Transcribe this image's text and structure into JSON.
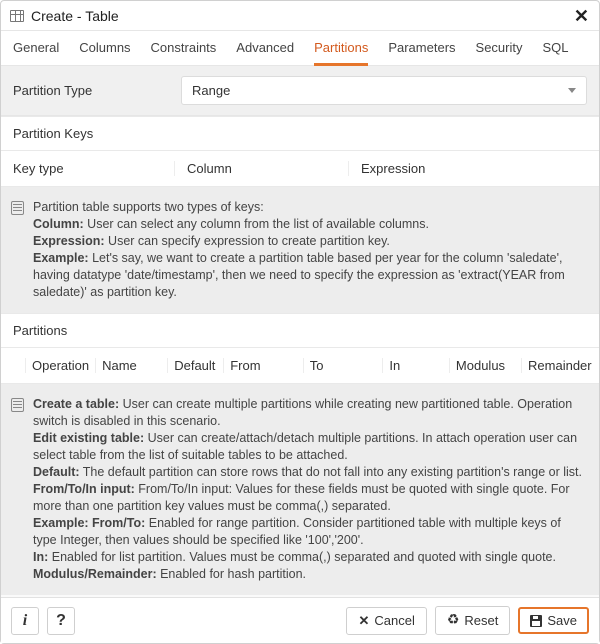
{
  "dialog_title": "Create - Table",
  "tabs": [
    "General",
    "Columns",
    "Constraints",
    "Advanced",
    "Partitions",
    "Parameters",
    "Security",
    "SQL"
  ],
  "active_tab_index": 4,
  "partition_type": {
    "label": "Partition Type",
    "value": "Range"
  },
  "partition_keys": {
    "header": "Partition Keys",
    "cols": [
      "Key type",
      "Column",
      "Expression"
    ]
  },
  "info1": {
    "intro": "Partition table supports two types of keys:",
    "column_label": "Column:",
    "column_text": " User can select any column from the list of available columns.",
    "expr_label": "Expression:",
    "expr_text": " User can specify expression to create partition key.",
    "example_label": "Example:",
    "example_text": " Let's say, we want to create a partition table based per year for the column 'saledate', having datatype 'date/timestamp', then we need to specify the expression as 'extract(YEAR from saledate)' as partition key."
  },
  "partitions": {
    "header": "Partitions",
    "cols": [
      "Operation",
      "Name",
      "Default",
      "From",
      "To",
      "In",
      "Modulus",
      "Remainder"
    ]
  },
  "info2": {
    "create_label": "Create a table:",
    "create_text": " User can create multiple partitions while creating new partitioned table. Operation switch is disabled in this scenario.",
    "edit_label": "Edit existing table:",
    "edit_text": " User can create/attach/detach multiple partitions. In attach operation user can select table from the list of suitable tables to be attached.",
    "default_label": "Default:",
    "default_text": " The default partition can store rows that do not fall into any existing partition's range or list.",
    "fti_label": "From/To/In input:",
    "fti_text": " From/To/In input: Values for these fields must be quoted with single quote. For more than one partition key values must be comma(,) separated.",
    "example_ft_label": "Example: From/To:",
    "example_ft_text": " Enabled for range partition. Consider partitioned table with multiple keys of type Integer, then values should be specified like '100','200'.",
    "in_label": "In:",
    "in_text": " Enabled for list partition. Values must be comma(,) separated and quoted with single quote.",
    "modrem_label": "Modulus/Remainder:",
    "modrem_text": " Enabled for hash partition."
  },
  "footer": {
    "info_label": "i",
    "help_label": "?",
    "cancel": "Cancel",
    "reset": "Reset",
    "save": "Save"
  }
}
